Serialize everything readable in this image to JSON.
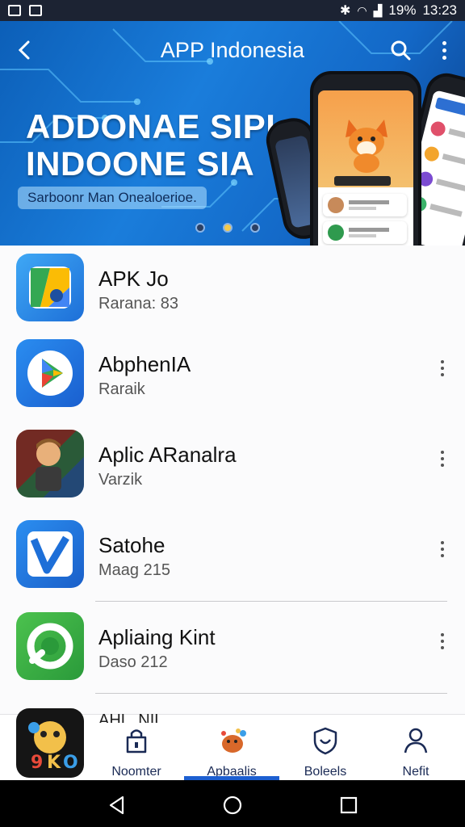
{
  "status_bar": {
    "battery": "19%",
    "time": "13:23"
  },
  "header": {
    "title": "APP Indonesia"
  },
  "banner": {
    "headline_line1": "ADDONAE SIPI",
    "headline_line2": "INDOONE SIA",
    "subtitle": "Sarboonr Man Onealoerioe.",
    "fox_panel_label": "",
    "carousel_count": 3
  },
  "apps": [
    {
      "name": "APK  Jo",
      "meta": "Rarana: 83",
      "icon": "maps-style-icon",
      "has_menu": false
    },
    {
      "name": "AbphenIA",
      "meta": "Raraik",
      "icon": "play-triangle-icon",
      "has_menu": true
    },
    {
      "name": "Aplic ARanalra",
      "meta": "Varzik",
      "icon": "character-avatar-icon",
      "has_menu": true
    },
    {
      "name": "Satohe",
      "meta": "Maag 215",
      "icon": "checkmark-v-icon",
      "has_menu": true
    },
    {
      "name": "Apliaing Kint",
      "meta": "Daso 212",
      "icon": "green-ring-icon",
      "has_menu": true
    }
  ],
  "peek_app": {
    "name": "AHL .NIL"
  },
  "bottom_nav": [
    {
      "label": "Noomter",
      "icon": "lock-bag-icon",
      "active": false
    },
    {
      "label": "Apbaalis",
      "icon": "mascot-icon",
      "active": true
    },
    {
      "label": "Boleels",
      "icon": "shield-face-icon",
      "active": false
    },
    {
      "label": "Nefit",
      "icon": "person-icon",
      "active": false
    }
  ],
  "colors": {
    "accent": "#1d5fd1",
    "banner": "#1a7ddb",
    "text": "#111111"
  }
}
